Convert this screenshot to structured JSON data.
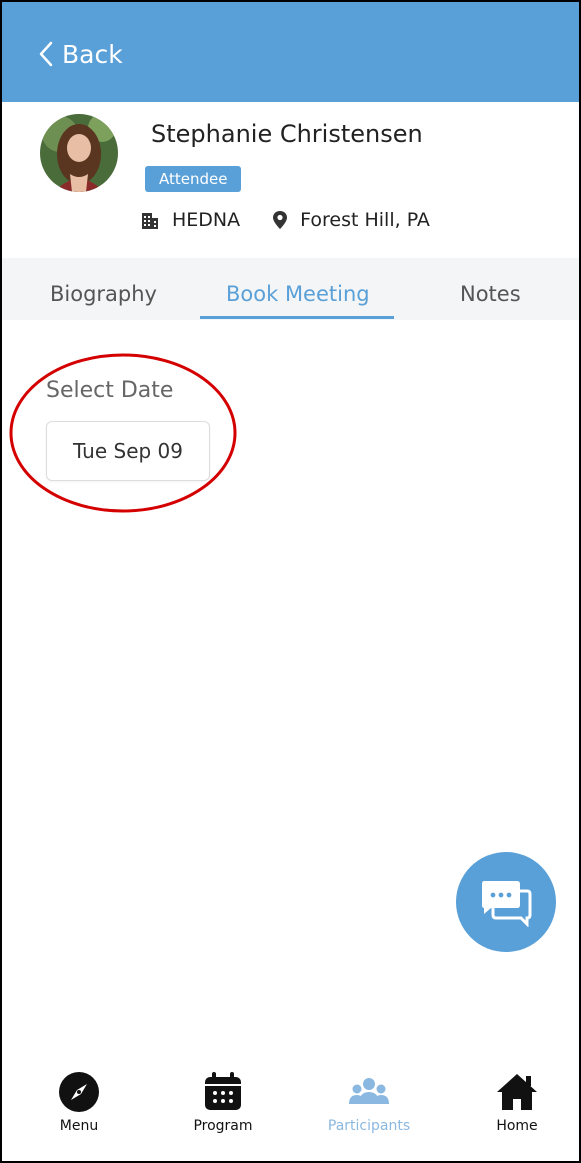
{
  "header": {
    "back_label": "Back"
  },
  "profile": {
    "name": "Stephanie Christensen",
    "role_badge": "Attendee",
    "organization": "HEDNA",
    "location": "Forest Hill, PA"
  },
  "tabs": [
    {
      "label": "Biography",
      "active": false
    },
    {
      "label": "Book Meeting",
      "active": true
    },
    {
      "label": "Notes",
      "active": false
    }
  ],
  "booking": {
    "select_date_label": "Select Date",
    "selected_date": "Tue Sep 09"
  },
  "bottom_nav": [
    {
      "label": "Menu",
      "icon": "compass-icon",
      "active": false
    },
    {
      "label": "Program",
      "icon": "calendar-icon",
      "active": false
    },
    {
      "label": "Participants",
      "icon": "people-icon",
      "active": true
    },
    {
      "label": "Home",
      "icon": "home-icon",
      "active": false
    }
  ],
  "colors": {
    "accent": "#5aa0d8",
    "annotation": "#d40000",
    "active_nav": "#8bb8e0"
  }
}
